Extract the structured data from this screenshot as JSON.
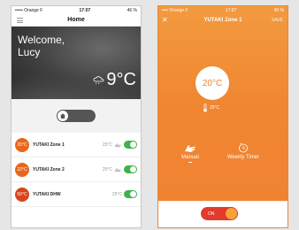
{
  "left": {
    "status": {
      "carrier": "••••• Orange F",
      "time": "17:07",
      "battery": "46 %"
    },
    "title": "Home",
    "welcome_line1": "Welcome,",
    "welcome_line2": "Lucy",
    "outside_temp": "9°C",
    "zones": [
      {
        "badge": "20°C",
        "name": "YUTAKI Zone 1",
        "setpoint": "25°C"
      },
      {
        "badge": "22°C",
        "name": "YUTAKI Zone 2",
        "setpoint": "25°C"
      },
      {
        "badge": "50°C",
        "name": "YUTAKI DHW",
        "setpoint": "25°C"
      }
    ],
    "colors": {
      "badge": "#e8671c",
      "switch_on": "#3fb24a"
    }
  },
  "right": {
    "status": {
      "carrier": "•••• Orange F",
      "time": "17:07",
      "battery": "45 %"
    },
    "title": "YUTAKI Zone 1",
    "close": "✕",
    "save": "SAVE",
    "target_temp": "20°C",
    "room_temp": "25°C",
    "mode_manual": "Manual",
    "mode_timer": "Weekly Timer",
    "on_label": "ON",
    "colors": {
      "accent": "#ef8232",
      "on_toggle": "#e03b2b"
    }
  }
}
